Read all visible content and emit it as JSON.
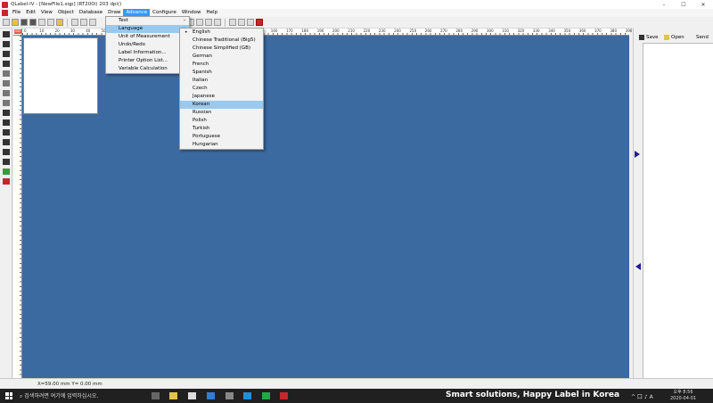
{
  "window": {
    "title": "QLabel-IV - [NewFile1.sqp]        (RT200i)        203 dpi()",
    "controls": [
      "–",
      "☐",
      "✕"
    ]
  },
  "menubar": {
    "items": [
      {
        "label": "File"
      },
      {
        "label": "Edit"
      },
      {
        "label": "View"
      },
      {
        "label": "Object"
      },
      {
        "label": "Database"
      },
      {
        "label": "Draw"
      },
      {
        "label": "Advance"
      },
      {
        "label": "Configure"
      },
      {
        "label": "Window"
      },
      {
        "label": "Help"
      }
    ]
  },
  "advance_menu": {
    "items": [
      {
        "label": "Test",
        "submenu": "›"
      },
      {
        "label": "Language",
        "submenu": "›"
      },
      {
        "label": "Unit of Measurement",
        "submenu": "›"
      },
      {
        "label": "Undo/Redo",
        "submenu": "›"
      },
      {
        "label": "Label Information..."
      },
      {
        "label": "Printer Option List..."
      },
      {
        "label": "Variable Calculation"
      }
    ]
  },
  "language_menu": {
    "items": [
      {
        "label": "English",
        "mark": "•"
      },
      {
        "label": "Chinese Traditional (Big5)"
      },
      {
        "label": "Chinese Simplified (GB)"
      },
      {
        "label": "German"
      },
      {
        "label": "French"
      },
      {
        "label": "Spanish"
      },
      {
        "label": "Italian"
      },
      {
        "label": "Czech"
      },
      {
        "label": "Japanese"
      },
      {
        "label": "Korean"
      },
      {
        "label": "Russian"
      },
      {
        "label": "Polish"
      },
      {
        "label": "Turkish"
      },
      {
        "label": "Portuguese"
      },
      {
        "label": "Hungarian"
      }
    ]
  },
  "ruler": {
    "unit": "mm",
    "ticks": [
      "0",
      "10",
      "20",
      "30",
      "40",
      "50",
      "60",
      "70",
      "80",
      "90",
      "100",
      "110",
      "120",
      "130",
      "140",
      "150",
      "160",
      "170",
      "180",
      "190",
      "200",
      "210",
      "220",
      "230",
      "240",
      "250",
      "260",
      "270",
      "280",
      "290",
      "300",
      "310",
      "320",
      "330",
      "340",
      "350",
      "360",
      "370",
      "380",
      "390",
      "400"
    ]
  },
  "right_panel": {
    "save_label": "Save",
    "open_label": "Open",
    "send_label": "Send"
  },
  "statusbar": {
    "coords": "X=59.00 mm   Y= 0.00 mm"
  },
  "taskbar": {
    "search_placeholder": "검색하려면 여기에 입력하십시오.",
    "slogan": "Smart solutions, Happy Label in Korea",
    "tray": "^ 口 ♪ A",
    "time": "오후 8:56",
    "date": "2020-04-01"
  },
  "colors": {
    "canvas": "#3b6aa0",
    "menu_active": "#3399ff",
    "menu_highlight": "#99c9ef",
    "taskbar": "#202020"
  }
}
